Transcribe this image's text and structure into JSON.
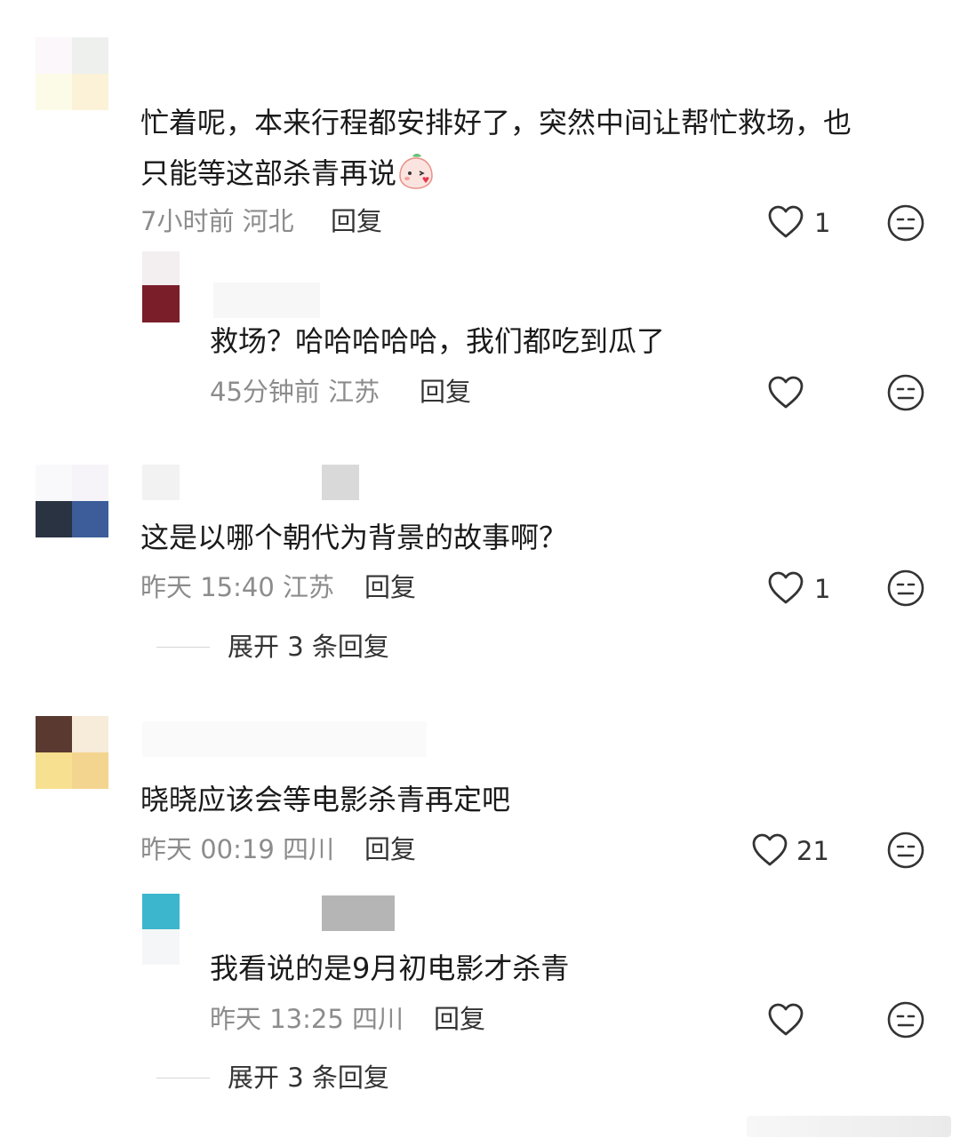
{
  "comments": [
    {
      "text_line1": "忙着呢，本来行程都安排好了，突然中间让帮忙救场，也",
      "text_line2": "只能等这部杀青再说",
      "time": "7小时前",
      "location": "河北",
      "reply_label": "回复",
      "likes": "1",
      "reply": {
        "text": "救场？哈哈哈哈哈，我们都吃到瓜了",
        "time": "45分钟前",
        "location": "江苏",
        "reply_label": "回复"
      }
    },
    {
      "text": "这是以哪个朝代为背景的故事啊？",
      "time": "昨天 15:40",
      "location": "江苏",
      "reply_label": "回复",
      "likes": "1",
      "expand_label": "展开 3 条回复"
    },
    {
      "text": "晓晓应该会等电影杀青再定吧",
      "time": "昨天 00:19",
      "location": "四川",
      "reply_label": "回复",
      "likes": "21",
      "reply": {
        "text": "我看说的是9月初电影才杀青",
        "time": "昨天 13:25",
        "location": "四川",
        "reply_label": "回复"
      },
      "expand_label": "展开 3 条回复"
    }
  ],
  "icons": {
    "like": "heart-outline-icon",
    "dislike": "neutral-face-icon",
    "emoji": "peach-kiss-emoji"
  }
}
